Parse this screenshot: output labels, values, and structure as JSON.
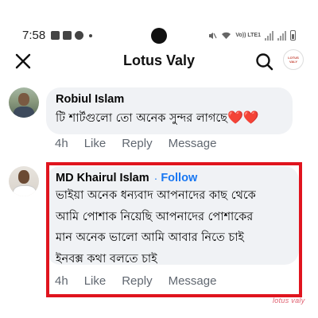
{
  "status_bar": {
    "time": "7:58",
    "network_label": "Vo)) LTE1"
  },
  "header": {
    "title": "Lotus Valy",
    "logo_text": "LOTUS VALY",
    "close_icon": "close-icon",
    "search_icon": "search-icon"
  },
  "comments": [
    {
      "author": "Robiul Islam",
      "text": "টি শার্টগুলো তো অনেক সুন্দর লাগছে",
      "emoji": "❤️❤️",
      "time": "4h",
      "like_label": "Like",
      "reply_label": "Reply",
      "message_label": "Message"
    },
    {
      "author": "MD Khairul Islam",
      "separator": "·",
      "follow_label": "Follow",
      "text_lines": [
        "ভাইয়া অনেক ধন্যবাদ আপনাদের কাছ থেকে",
        "আমি পোশাক নিয়েছি আপনাদের পোশাকের",
        "মান অনেক ভালো আমি আবার নিতে চাই",
        "ইনবক্স কথা বলতে চাই"
      ],
      "time": "4h",
      "like_label": "Like",
      "reply_label": "Reply",
      "message_label": "Message"
    }
  ],
  "watermark": "lotus valy",
  "colors": {
    "accent": "#1877f2",
    "highlight": "#e0141e",
    "bubble": "#f0f2f5",
    "heart": "#e41e3f"
  }
}
